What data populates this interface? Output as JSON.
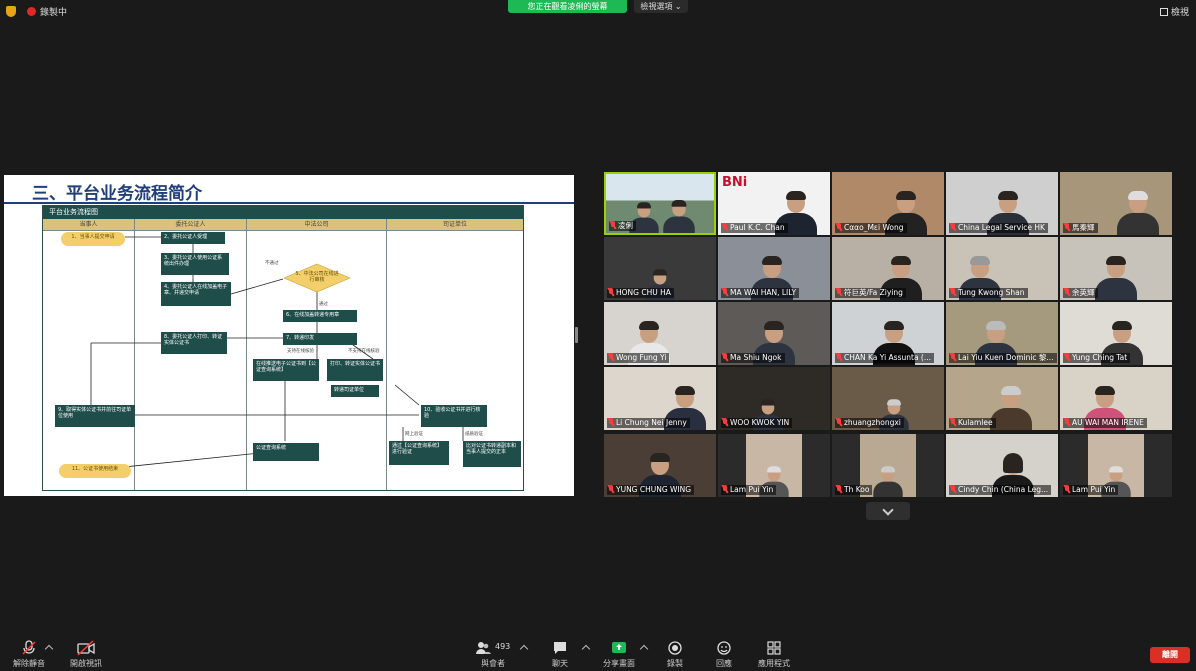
{
  "topbar": {
    "recording_label": "錄製中",
    "share_banner": "您正在觀看凌俐的螢幕",
    "view_options": "檢視選項",
    "view_button": "檢視"
  },
  "slide": {
    "title": "三、平台业务流程简介",
    "flow_header": "平台业务流程图",
    "lanes": [
      "当事人",
      "委托公证人",
      "中法公司",
      "司证单位"
    ],
    "nodes": {
      "n1": "1、当事人提交申请",
      "n2": "2、委托公证人受理",
      "n3": "3、委托公证人使用公证系统出件办理",
      "n4": "4、委托公证人在线加盖电子章、并递交申请",
      "d5": "5、中法公司在线进行审核",
      "n6": "6、在线加盖转递专用章",
      "n7": "7、转递印发",
      "n8": "8、委托公证人打印、转证实体公证书",
      "n9": "9、取得实体公证书并前往司证单位使用",
      "n10": "10、验收公证书并进行核验",
      "n11": "11、公证书使用结束",
      "ne1": "在线推送电子公证书到【公证查询系统】",
      "ne2": "打印、转证实体公证书",
      "ne3": "转递司证单位",
      "ne4": "公证查询系统",
      "ne5": "通过【公证查询系统】进行验证",
      "ne6": "比对公证书转递副本和当事人提交的正本"
    },
    "labels": {
      "reject": "不通过",
      "pass": "通过",
      "support_online": "支持在线核验",
      "no_support_online": "不支持在线核验",
      "online_verify": "网上验证",
      "paper_verify": "纸质验证"
    }
  },
  "participants": [
    {
      "name": "凌俐",
      "active": true
    },
    {
      "name": "Paul K.C. Chan",
      "active": false,
      "banner": "BNi"
    },
    {
      "name": "Cααo_Mεi Wong"
    },
    {
      "name": "China Legal Service HK"
    },
    {
      "name": "馬秦輝"
    },
    {
      "name": "HONG CHU HA"
    },
    {
      "name": "MA WAI HAN, LILY"
    },
    {
      "name": "符巨英/Fa Ziying"
    },
    {
      "name": "Tung Kwong Shan"
    },
    {
      "name": "余英輝"
    },
    {
      "name": "Wong Fung Yi"
    },
    {
      "name": "Ma Shiu Ngok"
    },
    {
      "name": "CHAN Ka Yi Assunta (..."
    },
    {
      "name": "Lai Yiu Kuen Dominic 黎..."
    },
    {
      "name": "Yung Ching Tat"
    },
    {
      "name": "Li Chung Nei Jenny"
    },
    {
      "name": "WOO KWOK YIN"
    },
    {
      "name": "zhuangzhongxi"
    },
    {
      "name": "Kulamlee"
    },
    {
      "name": "AU WAI MAN IRENE"
    },
    {
      "name": "YUNG CHUNG WING"
    },
    {
      "name": "Lam Pui Yin"
    },
    {
      "name": "Th Koo"
    },
    {
      "name": "Cindy Chin (China Leg..."
    },
    {
      "name": "Lam Pui Yin"
    }
  ],
  "toolbar": {
    "unmute": "解除靜音",
    "start_video": "開啟視訊",
    "participants": "與會者",
    "participants_count": "493",
    "chat": "聊天",
    "share_screen": "分享畫面",
    "record": "錄製",
    "reactions": "回應",
    "apps": "應用程式",
    "end": "離開"
  },
  "colors": {
    "accent_green": "#1db954",
    "end_red": "#d93025",
    "active_speaker": "#9ad100",
    "flow_teal": "#1e4d4a",
    "flow_yellow": "#f2cf6b"
  }
}
